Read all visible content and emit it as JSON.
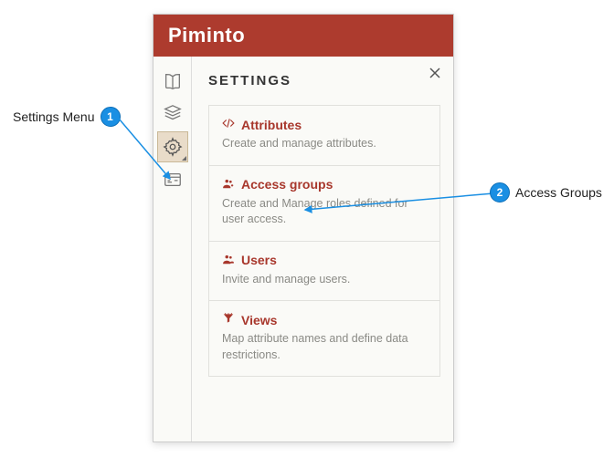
{
  "app": {
    "title": "Piminto"
  },
  "panel": {
    "title": "SETTINGS",
    "items": [
      {
        "label": "Attributes",
        "desc": "Create and manage attributes."
      },
      {
        "label": "Access groups",
        "desc": "Create and Manage roles defined for user access."
      },
      {
        "label": "Users",
        "desc": "Invite and manage users."
      },
      {
        "label": "Views",
        "desc": "Map attribute names and define data restrictions."
      }
    ]
  },
  "annotations": {
    "n1": {
      "num": "1",
      "label": "Settings Menu"
    },
    "n2": {
      "num": "2",
      "label": "Access Groups"
    }
  }
}
